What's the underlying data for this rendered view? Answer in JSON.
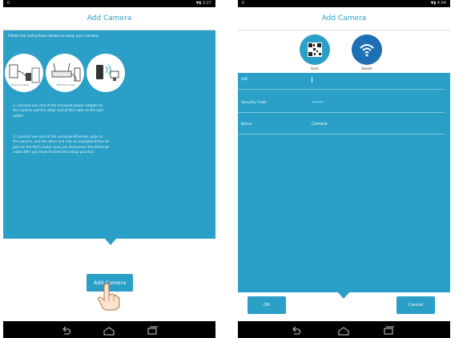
{
  "left_screen": {
    "status": {
      "left": "0",
      "right": "▼▮ 3:27"
    },
    "title": "Add Camera",
    "instructions_heading": "Follow the instructions below to setup your camera.",
    "step_1": "1. Connect one end of the enclosed power adapter to the camera and the other end of the cable to the wall outlet.",
    "step_2": "2. Connect one end of the enclosed Ethernet cable to the camera, and the other end into an available Ethernet port on the Wi-Fi router (you can disconnect the Ethernet cable after you have finished the setup process).",
    "add_camera_button": "Add Camera",
    "illustrations": [
      "power-plug-icon",
      "router-icon",
      "wifi-phone-icon"
    ],
    "nav_icons": [
      "back-icon",
      "home-icon",
      "recent-apps-icon"
    ]
  },
  "right_screen": {
    "status": {
      "left": "0",
      "right": "▼▮ 4:04"
    },
    "title": "Add Camera",
    "scan_label": "Scan",
    "search_label": "Search",
    "fields": [
      {
        "label": "UID",
        "value": ""
      },
      {
        "label": "Security Code",
        "value": "•••••"
      },
      {
        "label": "Name",
        "value": "Camera"
      }
    ],
    "ok_button": "OK",
    "cancel_button": "Cancel",
    "nav_icons": [
      "back-icon",
      "home-icon",
      "recent-apps-icon"
    ]
  },
  "colors": {
    "teal": "#2a9fc7",
    "search_blue": "#1d70b4",
    "title_text": "#2b9ec8",
    "bar_black": "#000000"
  }
}
